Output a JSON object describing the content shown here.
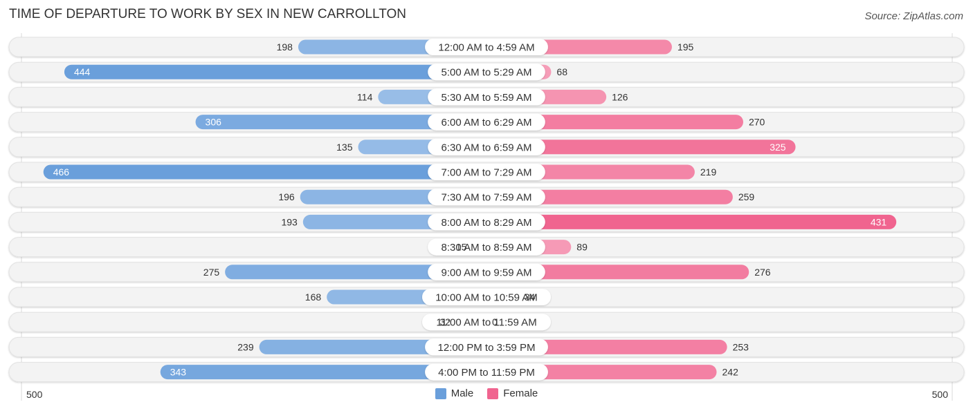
{
  "header": {
    "title": "TIME OF DEPARTURE TO WORK BY SEX IN NEW CARROLLTON",
    "source": "Source: ZipAtlas.com"
  },
  "colors": {
    "male_strong": "#6a9fdb",
    "male_light": "#a9c8ec",
    "female_strong": "#f0648f",
    "female_light": "#f7a8c0",
    "row_bg": "#f3f3f3"
  },
  "chart_data": {
    "type": "bar",
    "orientation": "horizontal-diverging",
    "title": "TIME OF DEPARTURE TO WORK BY SEX IN NEW CARROLLTON",
    "categories": [
      "12:00 AM to 4:59 AM",
      "5:00 AM to 5:29 AM",
      "5:30 AM to 5:59 AM",
      "6:00 AM to 6:29 AM",
      "6:30 AM to 6:59 AM",
      "7:00 AM to 7:29 AM",
      "7:30 AM to 7:59 AM",
      "8:00 AM to 8:29 AM",
      "8:30 AM to 8:59 AM",
      "9:00 AM to 9:59 AM",
      "10:00 AM to 10:59 AM",
      "11:00 AM to 11:59 AM",
      "12:00 PM to 3:59 PM",
      "4:00 PM to 11:59 PM"
    ],
    "series": [
      {
        "name": "Male",
        "values": [
          198,
          444,
          114,
          306,
          135,
          466,
          196,
          193,
          15,
          275,
          168,
          32,
          239,
          343
        ]
      },
      {
        "name": "Female",
        "values": [
          195,
          68,
          126,
          270,
          325,
          219,
          259,
          431,
          89,
          276,
          34,
          0,
          253,
          242
        ]
      }
    ],
    "xlim": [
      -500,
      500
    ],
    "axis_tick_labels": {
      "left": "500",
      "right": "500"
    },
    "legend": {
      "entries": [
        "Male",
        "Female"
      ],
      "placement": "bottom-center"
    },
    "grid": false
  }
}
